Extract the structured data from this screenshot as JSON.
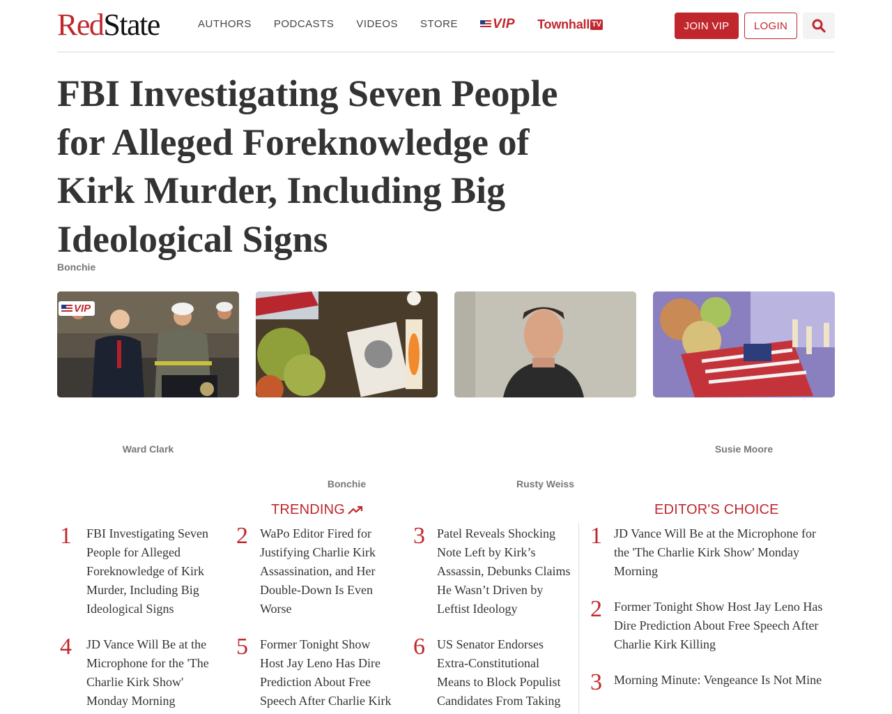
{
  "header": {
    "logo_red": "Red",
    "logo_dark": "State",
    "nav": [
      "AUTHORS",
      "PODCASTS",
      "VIDEOS",
      "STORE"
    ],
    "vip_label": "VIP",
    "townhall_label": "Townhall",
    "townhall_tv": "TV",
    "join_label": "JOIN VIP",
    "login_label": "LOGIN",
    "search_icon": "search-icon",
    "accent_color": "#c0272d"
  },
  "article": {
    "headline": "FBI Investigating Seven People for Alleged Foreknowledge of Kirk Murder, Including Big Ideological Signs",
    "byline": "Bonchie"
  },
  "cards": [
    {
      "author": "Ward Clark",
      "vip": "VIP"
    },
    {
      "author": "Bonchie"
    },
    {
      "author": "Rusty Weiss"
    },
    {
      "author": "Susie Moore"
    }
  ],
  "trending": {
    "title": "TRENDING",
    "items": [
      {
        "num": "1",
        "text": "FBI Investigating Seven People for Alleged Foreknowledge of Kirk Murder, Including Big Ideological Signs"
      },
      {
        "num": "2",
        "text": "WaPo Editor Fired for Justifying Charlie Kirk Assassination, and Her Double-Down Is Even Worse"
      },
      {
        "num": "3",
        "text": "Patel Reveals Shocking Note Left by Kirk’s Assassin, Debunks Claims He Wasn’t Driven by Leftist Ideology"
      },
      {
        "num": "4",
        "text": "JD Vance Will Be at the Microphone for the 'The Charlie Kirk Show' Monday Morning"
      },
      {
        "num": "5",
        "text": "Former Tonight Show Host Jay Leno Has Dire Prediction About Free Speech After Charlie Kirk Killing"
      },
      {
        "num": "6",
        "text": "US Senator Endorses Extra-Constitutional Means to Block Populist Candidates From Taking Office"
      }
    ]
  },
  "editors_choice": {
    "title": "EDITOR'S CHOICE",
    "items": [
      {
        "num": "1",
        "text": "JD Vance Will Be at the Microphone for the 'The Charlie Kirk Show' Monday Morning"
      },
      {
        "num": "2",
        "text": "Former Tonight Show Host Jay Leno Has Dire Prediction About Free Speech After Charlie Kirk Killing"
      },
      {
        "num": "3",
        "text": "Morning Minute: Vengeance Is Not Mine"
      }
    ]
  }
}
